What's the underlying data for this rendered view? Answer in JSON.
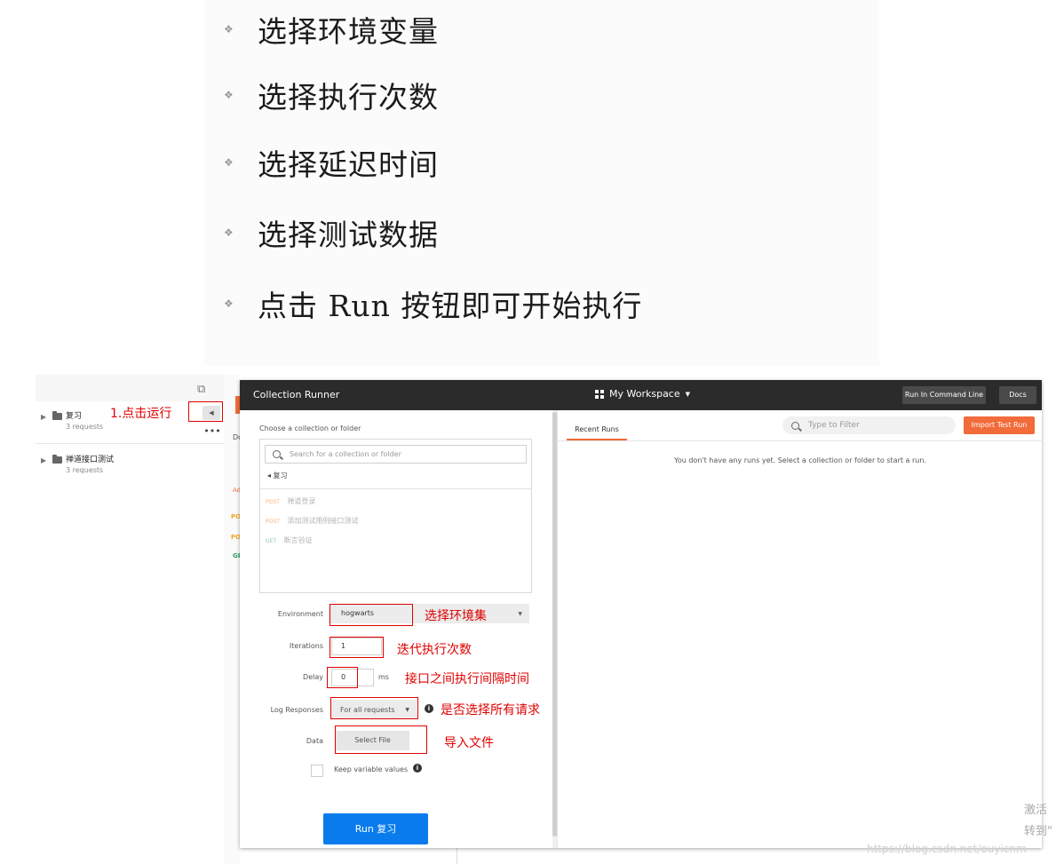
{
  "slide": {
    "bullets": [
      "选择环境变量",
      "选择执行次数",
      "选择延迟时间",
      "选择测试数据",
      "点击 Run 按钮即可开始执行"
    ]
  },
  "sidebar": {
    "collections": [
      {
        "name": "复习",
        "count": "3 requests"
      },
      {
        "name": "禅道接口测试",
        "count": "3 requests"
      }
    ],
    "more_label": "•••",
    "bg_letters": [
      "Do",
      "Ad",
      "PO",
      "PO",
      "GE"
    ]
  },
  "runner": {
    "title": "Collection Runner",
    "workspace": "My Workspace",
    "btn_cmdline": "Run In Command Line",
    "btn_docs": "Docs",
    "choose_label": "Choose a collection or folder",
    "search_placeholder": "Search for a collection or folder",
    "breadcrumb": "◂  复习",
    "requests": [
      {
        "method": "POST",
        "name": "禅道登录"
      },
      {
        "method": "POST",
        "name": "添加测试用例接口测试"
      },
      {
        "method": "GET",
        "name": "断言验证"
      }
    ],
    "environment_label": "Environment",
    "environment_value": "hogwarts",
    "iterations_label": "Iterations",
    "iterations_value": "1",
    "delay_label": "Delay",
    "delay_value": "0",
    "delay_unit": "ms",
    "log_label": "Log Responses",
    "log_value": "For all requests",
    "data_label": "Data",
    "select_file": "Select File",
    "keep_label": "Keep variable values",
    "run_button": "Run 复习",
    "tab_recent": "Recent Runs",
    "filter_placeholder": "Type to Filter",
    "import_button": "Import Test Run",
    "no_runs": "You don't have any runs yet. Select a collection or folder to start a run."
  },
  "annotations": {
    "run": "1.点击运行",
    "env": "选择环境集",
    "iter": "迭代执行次数",
    "delay": "接口之间执行间隔时间",
    "log": "是否选择所有请求",
    "data": "导入文件"
  },
  "watermark": {
    "line1": "激活",
    "line2": "转到\"",
    "url": "https://blog.csdn.net/ouyicnm"
  },
  "colors": {
    "accent_orange": "#f26b3a",
    "run_blue": "#097bed",
    "annotation_red": "#e00000",
    "header_dark": "#2b2b2b"
  }
}
